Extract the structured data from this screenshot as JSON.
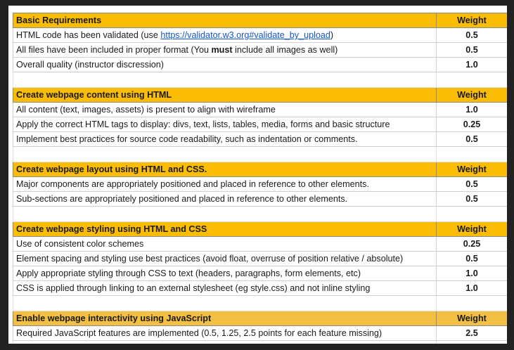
{
  "weight_label": "Weight",
  "sections": [
    {
      "title": "Basic Requirements",
      "rows": [
        {
          "pre": "HTML code has been validated (use ",
          "link": "https://validator.w3.org#validate_by_upload",
          "post": ")",
          "weight": "0.5"
        },
        {
          "pre": "All files have been included in proper format (You ",
          "bold": "must",
          "post": " include all images as well)",
          "weight": "0.5"
        },
        {
          "text": "Overall quality (instructor discression)",
          "weight": "1.0"
        }
      ]
    },
    {
      "title": "Create webpage content using HTML",
      "rows": [
        {
          "text": "All content (text, images, assets) is present to align with wireframe",
          "weight": "1.0"
        },
        {
          "text": "Apply the correct HTML tags to display: divs, text, lists, tables, media, forms and basic structure",
          "weight": "0.25"
        },
        {
          "text": "Implement best practices for source code readability, such as indentation or comments.",
          "weight": "0.5"
        }
      ]
    },
    {
      "title": "Create webpage layout using HTML and CSS.",
      "rows": [
        {
          "text": "Major components are appropriately positioned and placed in reference to other elements.",
          "weight": "0.5"
        },
        {
          "text": "Sub-sections are appropriately positioned and placed in reference to other elements.",
          "weight": "0.5"
        }
      ]
    },
    {
      "title": "Create webpage styling using HTML and CSS",
      "rows": [
        {
          "text": "Use of consistent color schemes",
          "weight": "0.25"
        },
        {
          "text": "Element spacing and styling use best practices (avoid float, overruse of position relative / absolute)",
          "weight": "0.5"
        },
        {
          "text": "Apply appropriate styling through CSS to text (headers, paragraphs, form elements, etc)",
          "weight": "1.0"
        },
        {
          "text": "CSS is applied through linking to an external stylesheet (eg style.css) and not inline styling",
          "weight": "1.0"
        }
      ]
    },
    {
      "title": "Enable webpage interactivity using JavaScript",
      "rows": [
        {
          "text": "Required JavaScript features are implemented (0.5, 1.25, 2.5 points for each feature missing)",
          "weight": "2.5"
        }
      ]
    }
  ],
  "colors": {
    "header_bg": "#fbbc04",
    "header_bg_last": "#f3c044",
    "link": "#1155cc",
    "frame": "#222222"
  }
}
